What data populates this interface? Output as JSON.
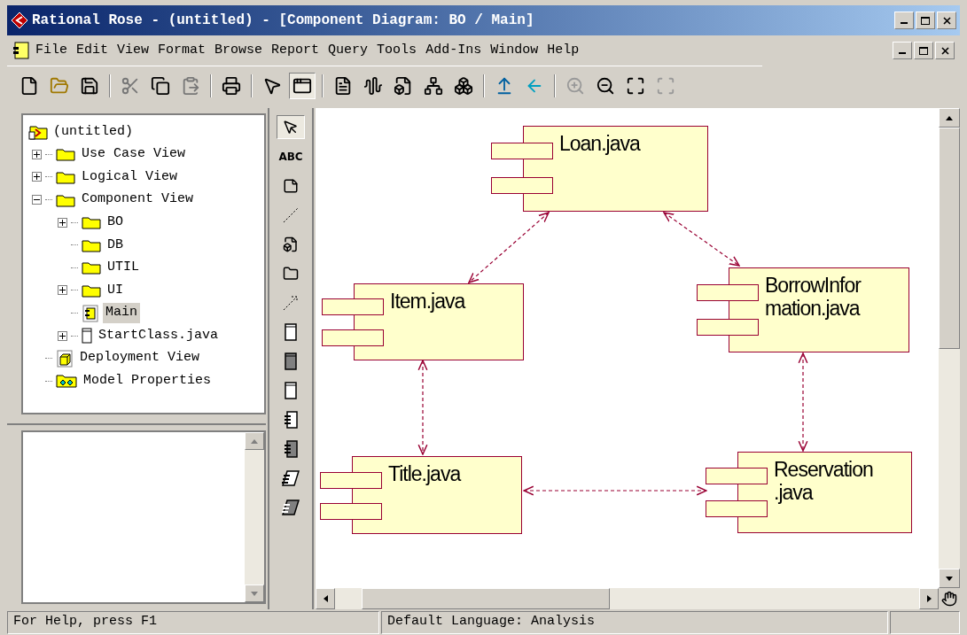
{
  "window": {
    "title": "Rational Rose - (untitled) - [Component Diagram: BO / Main]"
  },
  "menu": [
    "File",
    "Edit",
    "View",
    "Format",
    "Browse",
    "Report",
    "Query",
    "Tools",
    "Add-Ins",
    "Window",
    "Help"
  ],
  "tree": {
    "label": "(untitled)",
    "kind": "model",
    "children": [
      {
        "label": "Use Case View",
        "kind": "folder",
        "expanded": false,
        "selected": false
      },
      {
        "label": "Logical View",
        "kind": "folder",
        "expanded": false,
        "selected": false
      },
      {
        "label": "Component View",
        "kind": "folder",
        "expanded": true,
        "selected": false,
        "children": [
          {
            "label": "BO",
            "kind": "folder",
            "expanded": false,
            "selected": false
          },
          {
            "label": "DB",
            "kind": "folder",
            "selected": false
          },
          {
            "label": "UTIL",
            "kind": "folder",
            "selected": false
          },
          {
            "label": "UI",
            "kind": "folder",
            "expanded": false,
            "selected": false
          },
          {
            "label": "Main",
            "kind": "diagram",
            "selected": true
          },
          {
            "label": "StartClass.java",
            "kind": "file",
            "expanded": false,
            "selected": false
          }
        ]
      },
      {
        "label": "Deployment View",
        "kind": "deployment",
        "selected": false
      },
      {
        "label": "Model Properties",
        "kind": "properties",
        "selected": false
      }
    ]
  },
  "palette": [
    {
      "kind": "select",
      "selected": true
    },
    {
      "kind": "text",
      "label": "ABC",
      "selected": false
    },
    {
      "kind": "note",
      "selected": false
    },
    {
      "kind": "anchor",
      "selected": false
    },
    {
      "kind": "component",
      "selected": false
    },
    {
      "kind": "package",
      "selected": false
    },
    {
      "kind": "dependency",
      "selected": false
    },
    {
      "kind": "spec",
      "selected": false
    },
    {
      "kind": "body",
      "selected": false
    },
    {
      "kind": "spec",
      "selected": false
    },
    {
      "kind": "task",
      "selected": false
    },
    {
      "kind": "taskbody",
      "selected": false
    },
    {
      "kind": "main",
      "selected": false
    },
    {
      "kind": "mainbody",
      "selected": false
    }
  ],
  "diagram": {
    "components": [
      {
        "lines": [
          "Loan.java"
        ]
      },
      {
        "lines": [
          "Item.java"
        ]
      },
      {
        "lines": [
          "BorrowInfor",
          "mation.java"
        ]
      },
      {
        "lines": [
          "Title.java"
        ]
      },
      {
        "lines": [
          "Reservation",
          ".java"
        ]
      }
    ]
  },
  "status_bar": [
    "For Help, press F1",
    "Default Language: Analysis"
  ]
}
